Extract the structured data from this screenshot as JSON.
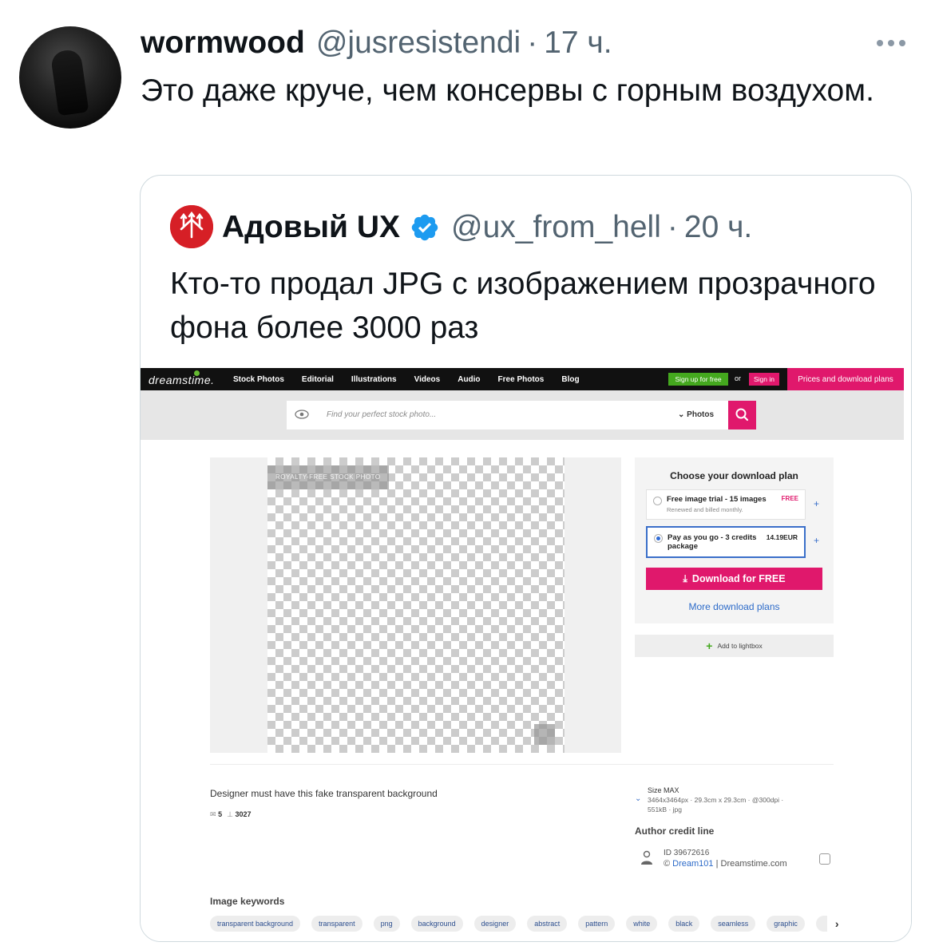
{
  "tweet": {
    "name": "wormwood",
    "handle": "@jusresistendi",
    "separator": "·",
    "time": "17 ч.",
    "text": "Это даже круче, чем консервы с горным воздухом."
  },
  "quote": {
    "name": "Адовый UX",
    "handle": "@ux_from_hell",
    "separator": "·",
    "time": "20 ч.",
    "text": "Кто-то продал JPG с изображением прозрачного фона более 3000 раз",
    "verified_color": "#1d9bf0",
    "avatar_color": "#d61f26"
  },
  "screenshot": {
    "logo": "dreamstime.",
    "nav": [
      "Stock Photos",
      "Editorial",
      "Illustrations",
      "Videos",
      "Audio",
      "Free Photos",
      "Blog"
    ],
    "signup": "Sign up for free",
    "or": "or",
    "signin": "Sign in",
    "prices": "Prices and download plans",
    "search_placeholder": "Find your perfect stock photo...",
    "search_select": "Photos",
    "royalty_label": "ROYALTY-FREE STOCK PHOTO",
    "plan_title": "Choose your download plan",
    "option1_title": "Free image trial - 15 images",
    "option1_sub": "Renewed and billed monthly.",
    "option1_badge": "FREE",
    "option2_title": "Pay as you go - 3 credits package",
    "option2_price": "14.19EUR",
    "download_button": "Download for FREE",
    "more_plans": "More download plans",
    "lightbox": "Add to lightbox",
    "caption": "Designer must have this fake transparent background",
    "stat_likes": "5",
    "stat_downloads": "3027",
    "size_title": "Size MAX",
    "size_line1": "3464x3464px · 29.3cm x 29.3cm · @300dpi ·",
    "size_line2": "551kB · jpg",
    "credit_title": "Author credit line",
    "credit_id": "ID 39672616",
    "credit_prefix": "©",
    "credit_author": "Dream101",
    "credit_suffix": "| Dreamstime.com",
    "keywords_title": "Image keywords",
    "keywords": [
      "transparent background",
      "transparent",
      "png",
      "background",
      "designer",
      "abstract",
      "pattern",
      "white",
      "black",
      "seamless",
      "graphic"
    ],
    "accent_color": "#e0186c",
    "green_color": "#44a81e"
  }
}
